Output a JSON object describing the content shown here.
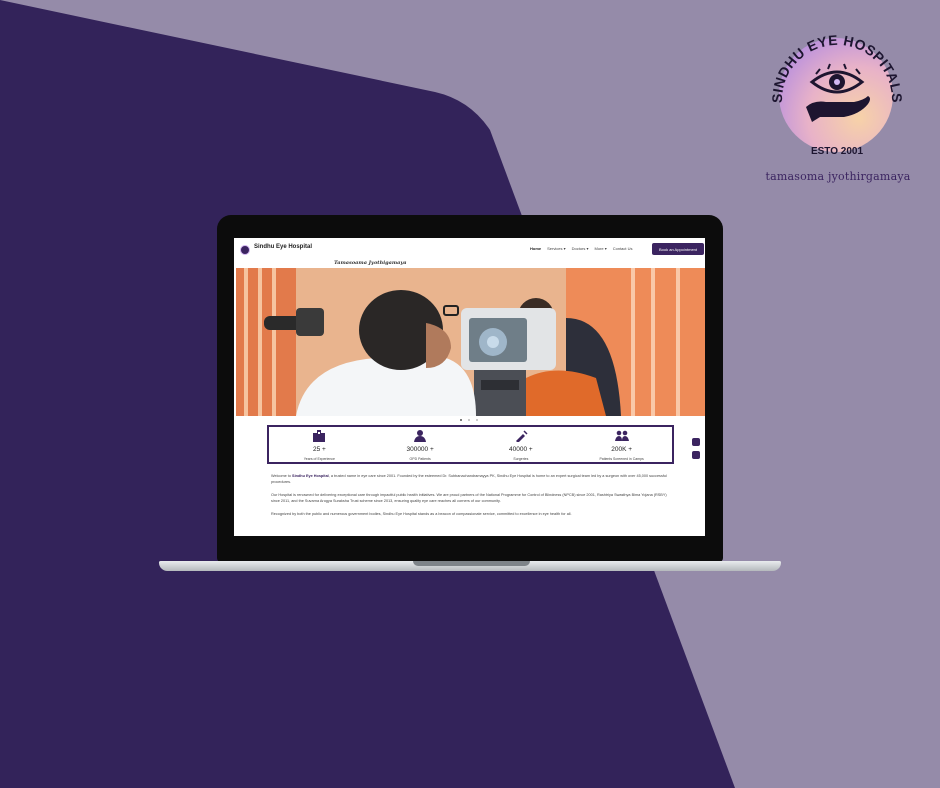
{
  "logo": {
    "name": "SINDHU EYE HOSPITALS",
    "established": "ESTO 2001",
    "tagline": "tamasoma jyothirgamaya"
  },
  "site": {
    "brand": "Sindhu Eye Hospital",
    "motto": "Tamasoama Jyothigamaya",
    "nav": [
      "Home",
      "Services ▾",
      "Doctors ▾",
      "More ▾",
      "Contact Us"
    ],
    "cta": "Book an Appointment",
    "slides": 3,
    "active_slide": 0,
    "stats": [
      {
        "value": "25 +",
        "label": "Years of Experience",
        "icon": "hospital-icon"
      },
      {
        "value": "300000 +",
        "label": "OPD Patients",
        "icon": "doctor-icon"
      },
      {
        "value": "40000 +",
        "label": "Surgeries",
        "icon": "syringe-icon"
      },
      {
        "value": "200K +",
        "label": "Patients Screened in Camps",
        "icon": "people-icon"
      }
    ],
    "intro_prefix": "Welcome to ",
    "intro_name": "Sindhu Eye Hospital",
    "intro_rest": ", a trusted name in eye care since 2001. Founded by the esteemed Dr. Subbanachandramayya PK, Sindhu Eye Hospital is home to an expert surgical team led by a surgeon with over 45,000 successful procedures.",
    "para2": "Our Hospital is renowned for delivering exceptional care through impactful public health initiatives. We are proud partners of the National Programme for Control of Blindness (NPCB) since 2001, Rashtriya Swasthya Bima Yojana (RSBY) since 2011, and the Suvarna Arogya Suraksha Trust scheme since 2013, ensuring quality eye care reaches all corners of our community.",
    "para3": "Recognized by both the public and numerous government bodies, Sindhu Eye Hospital stands as a beacon of compassionate service, committed to excellence in eye health for all."
  },
  "colors": {
    "brand": "#3b2460",
    "page_bg": "#958ba9",
    "dark_shape": "#33235a"
  }
}
